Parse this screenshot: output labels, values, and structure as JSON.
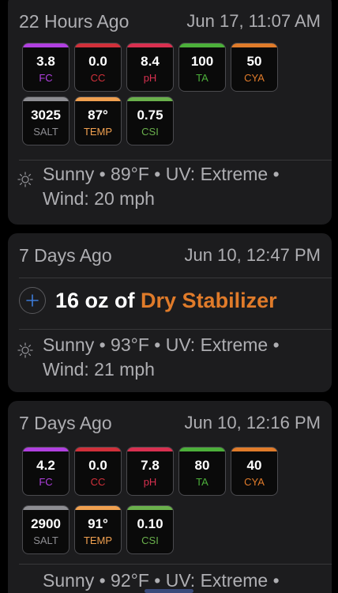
{
  "colors": {
    "fc": "#b040e0",
    "cc": "#d0303a",
    "ph": "#d83050",
    "ta": "#4caf3a",
    "cya": "#e07b2a",
    "salt": "#8e8e93",
    "temp": "#f0a050",
    "csi": "#6ab04c",
    "accent_blue": "#3d7bd9"
  },
  "entries": [
    {
      "ago": "22 Hours Ago",
      "date": "Jun 17, 11:07 AM",
      "readings": [
        {
          "value": "3.8",
          "label": "FC"
        },
        {
          "value": "0.0",
          "label": "CC"
        },
        {
          "value": "8.4",
          "label": "pH"
        },
        {
          "value": "100",
          "label": "TA"
        },
        {
          "value": "50",
          "label": "CYA"
        },
        {
          "value": "3025",
          "label": "SALT"
        },
        {
          "value": "87°",
          "label": "TEMP"
        },
        {
          "value": "0.75",
          "label": "CSI"
        }
      ],
      "weather_icon": "sun-icon",
      "weather_line1": "Sunny • 89°F • UV: Extreme •",
      "weather_line2": "Wind: 20 mph"
    },
    {
      "ago": "7 Days Ago",
      "date": "Jun 10, 12:47 PM",
      "dose_icon": "plus-circle-icon",
      "dose_amount": "16 oz of",
      "dose_chemical": "Dry Stabilizer",
      "weather_icon": "sun-icon",
      "weather_line1": "Sunny • 93°F • UV: Extreme •",
      "weather_line2": "Wind: 21 mph"
    },
    {
      "ago": "7 Days Ago",
      "date": "Jun 10, 12:16 PM",
      "readings": [
        {
          "value": "4.2",
          "label": "FC"
        },
        {
          "value": "0.0",
          "label": "CC"
        },
        {
          "value": "7.8",
          "label": "pH"
        },
        {
          "value": "80",
          "label": "TA"
        },
        {
          "value": "40",
          "label": "CYA"
        },
        {
          "value": "2900",
          "label": "SALT"
        },
        {
          "value": "91°",
          "label": "TEMP"
        },
        {
          "value": "0.10",
          "label": "CSI"
        }
      ],
      "weather_icon": "sun-icon",
      "weather_line1": "Sunny • 92°F • UV: Extreme •"
    }
  ]
}
